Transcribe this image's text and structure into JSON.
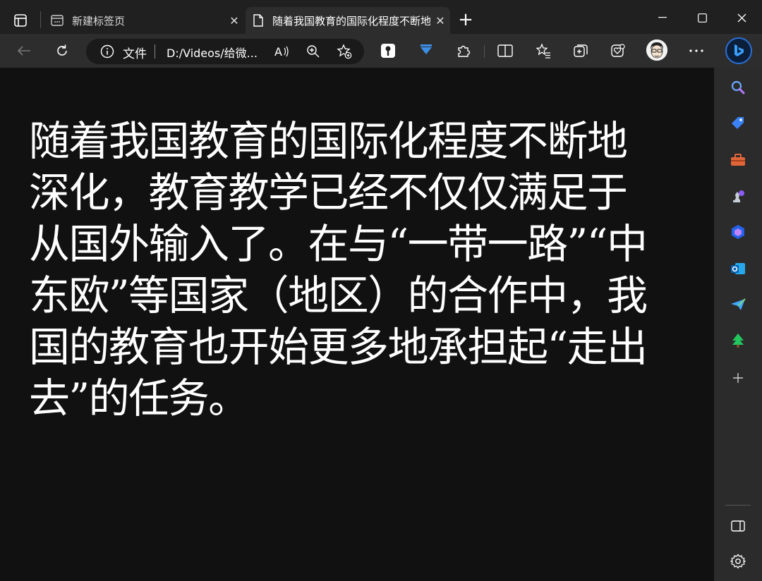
{
  "tabs": [
    {
      "title": "新建标签页",
      "close": "✕"
    },
    {
      "title": "随着我国教育的国际化程度不断地深化",
      "close": "✕"
    }
  ],
  "new_tab_label": "+",
  "address": {
    "scheme_label": "文件",
    "url": "D:/Videos/给微..."
  },
  "content": {
    "text": "随着我国教育的国际化程度不断地深化，教育教学已经不仅仅满足于从国外输入了。在与“一带一路”“中东欧”等国家（地区）的合作中，我国的教育也开始更多地承担起“走出去”的任务。"
  },
  "colors": {
    "page_bg": "#111111",
    "chrome_bg": "#202020",
    "toolbar_bg": "#2d2d2d",
    "accent": "#2a6fd8"
  },
  "icons": {
    "sidebar": [
      "search-icon",
      "shopping-tag-icon",
      "toolbox-icon",
      "games-icon",
      "copilot-icon",
      "outlook-icon",
      "send-icon",
      "tree-icon",
      "add-icon",
      "sidebar-toggle-icon",
      "settings-icon"
    ]
  }
}
